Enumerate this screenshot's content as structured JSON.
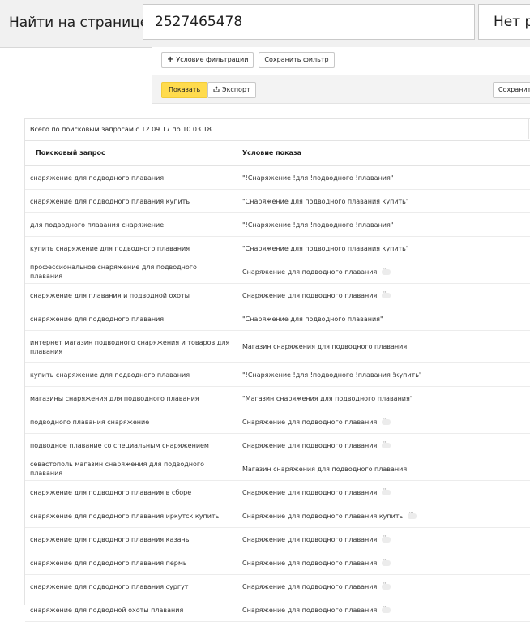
{
  "find_bar": {
    "label": "Найти на странице",
    "query": "2527465478",
    "status": "Нет ре"
  },
  "filter_panel": {
    "add_condition_label": "Условие фильтрации",
    "save_filter_label": "Сохранить фильтр",
    "show_label": "Показать",
    "export_label": "Экспорт",
    "save_right_label": "Сохранить о"
  },
  "report": {
    "caption": "Всего по поисковым запросам с 12.09.17 по 10.03.18",
    "columns": [
      "Поисковый запрос",
      "Условие показа"
    ],
    "rows": [
      {
        "query": "снаряжение для подводного плавания",
        "condition": "\"!Снаряжение !для !подводного !плавания\"",
        "more": false
      },
      {
        "query": "снаряжение для подводного плавания купить",
        "condition": "\"Снаряжение для подводного плавания купить\"",
        "more": false
      },
      {
        "query": "для подводного плавания снаряжение",
        "condition": "\"!Снаряжение !для !подводного !плавания\"",
        "more": false
      },
      {
        "query": "купить снаряжение для подводного плавания",
        "condition": "\"Снаряжение для подводного плавания купить\"",
        "more": false
      },
      {
        "query": "профессиональное снаряжение для подводного плавания",
        "condition": "Снаряжение для подводного плавания",
        "more": true
      },
      {
        "query": "снаряжение для плавания и подводной охоты",
        "condition": "Снаряжение для подводного плавания",
        "more": true
      },
      {
        "query": "снаряжение для подводного плавания",
        "condition": "\"Снаряжение для подводного плавания\"",
        "more": false
      },
      {
        "query": "интернет магазин подводного снаряжения и товаров для плавания",
        "condition": "Магазин снаряжения для подводного плавания",
        "more": false
      },
      {
        "query": "купить снаряжение для подводного плавания",
        "condition": "\"!Снаряжение !для !подводного !плавания !купить\"",
        "more": false
      },
      {
        "query": "магазины снаряжения для подводного плавания",
        "condition": "\"Магазин снаряжения для подводного плавания\"",
        "more": false
      },
      {
        "query": "подводного плавания снаряжение",
        "condition": "Снаряжение для подводного плавания",
        "more": true
      },
      {
        "query": "подводное плавание со специальным снаряжением",
        "condition": "Снаряжение для подводного плавания",
        "more": true
      },
      {
        "query": "севастополь магазин снаряжения для подводного плавания",
        "condition": "Магазин снаряжения для подводного плавания",
        "more": false
      },
      {
        "query": "снаряжение для подводного плавания в сборе",
        "condition": "Снаряжение для подводного плавания",
        "more": true
      },
      {
        "query": "снаряжение для подводного плавания иркутск купить",
        "condition": "Снаряжение для подводного плавания купить",
        "more": true
      },
      {
        "query": "снаряжение для подводного плавания казань",
        "condition": "Снаряжение для подводного плавания",
        "more": true
      },
      {
        "query": "снаряжение для подводного плавания пермь",
        "condition": "Снаряжение для подводного плавания",
        "more": true
      },
      {
        "query": "снаряжение для подводного плавания сургут",
        "condition": "Снаряжение для подводного плавания",
        "more": true
      },
      {
        "query": "снаряжение для подводной охоты плавания",
        "condition": "Снаряжение для подводного плавания",
        "more": true
      }
    ]
  }
}
